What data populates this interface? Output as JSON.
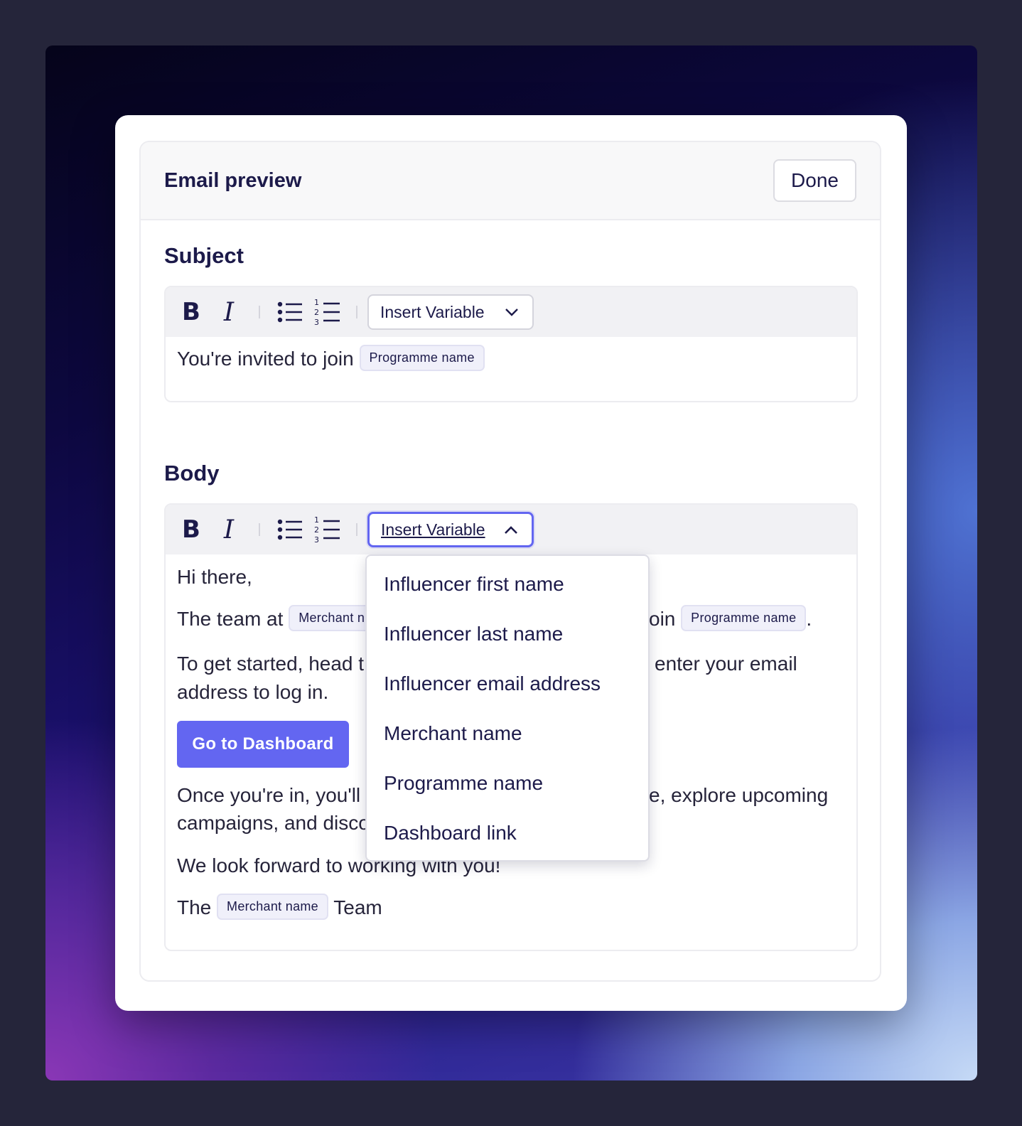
{
  "header": {
    "title": "Email preview",
    "done_label": "Done"
  },
  "subject": {
    "title": "Subject",
    "toolbar": {
      "bold": "B",
      "italic": "I",
      "insert_variable": "Insert Variable"
    },
    "text": "You're invited to join",
    "variable": "Programme name"
  },
  "body": {
    "title": "Body",
    "toolbar": {
      "bold": "B",
      "italic": "I",
      "insert_variable": "Insert Variable"
    },
    "greeting": "Hi there,",
    "line2_start": "The team at",
    "line2_var1": "Merchant n",
    "line2_mid": "oin",
    "line2_var2": "Programme name",
    "line2_end": ".",
    "line3a_start": "To get started, head t",
    "line3a_end": "enter your email",
    "line3b": "address to log in.",
    "cta_label": "Go to Dashboard",
    "line4a_start": "Once you're in, you'll",
    "line4a_end": "e, explore upcoming",
    "line4b": "campaigns, and disco",
    "line5": "We look forward to working with you!",
    "sign_start": "The",
    "sign_var": "Merchant name",
    "sign_end": "Team"
  },
  "dropdown": {
    "items": [
      "Influencer first name",
      "Influencer last name",
      "Influencer email address",
      "Merchant name",
      "Programme name",
      "Dashboard link"
    ]
  }
}
